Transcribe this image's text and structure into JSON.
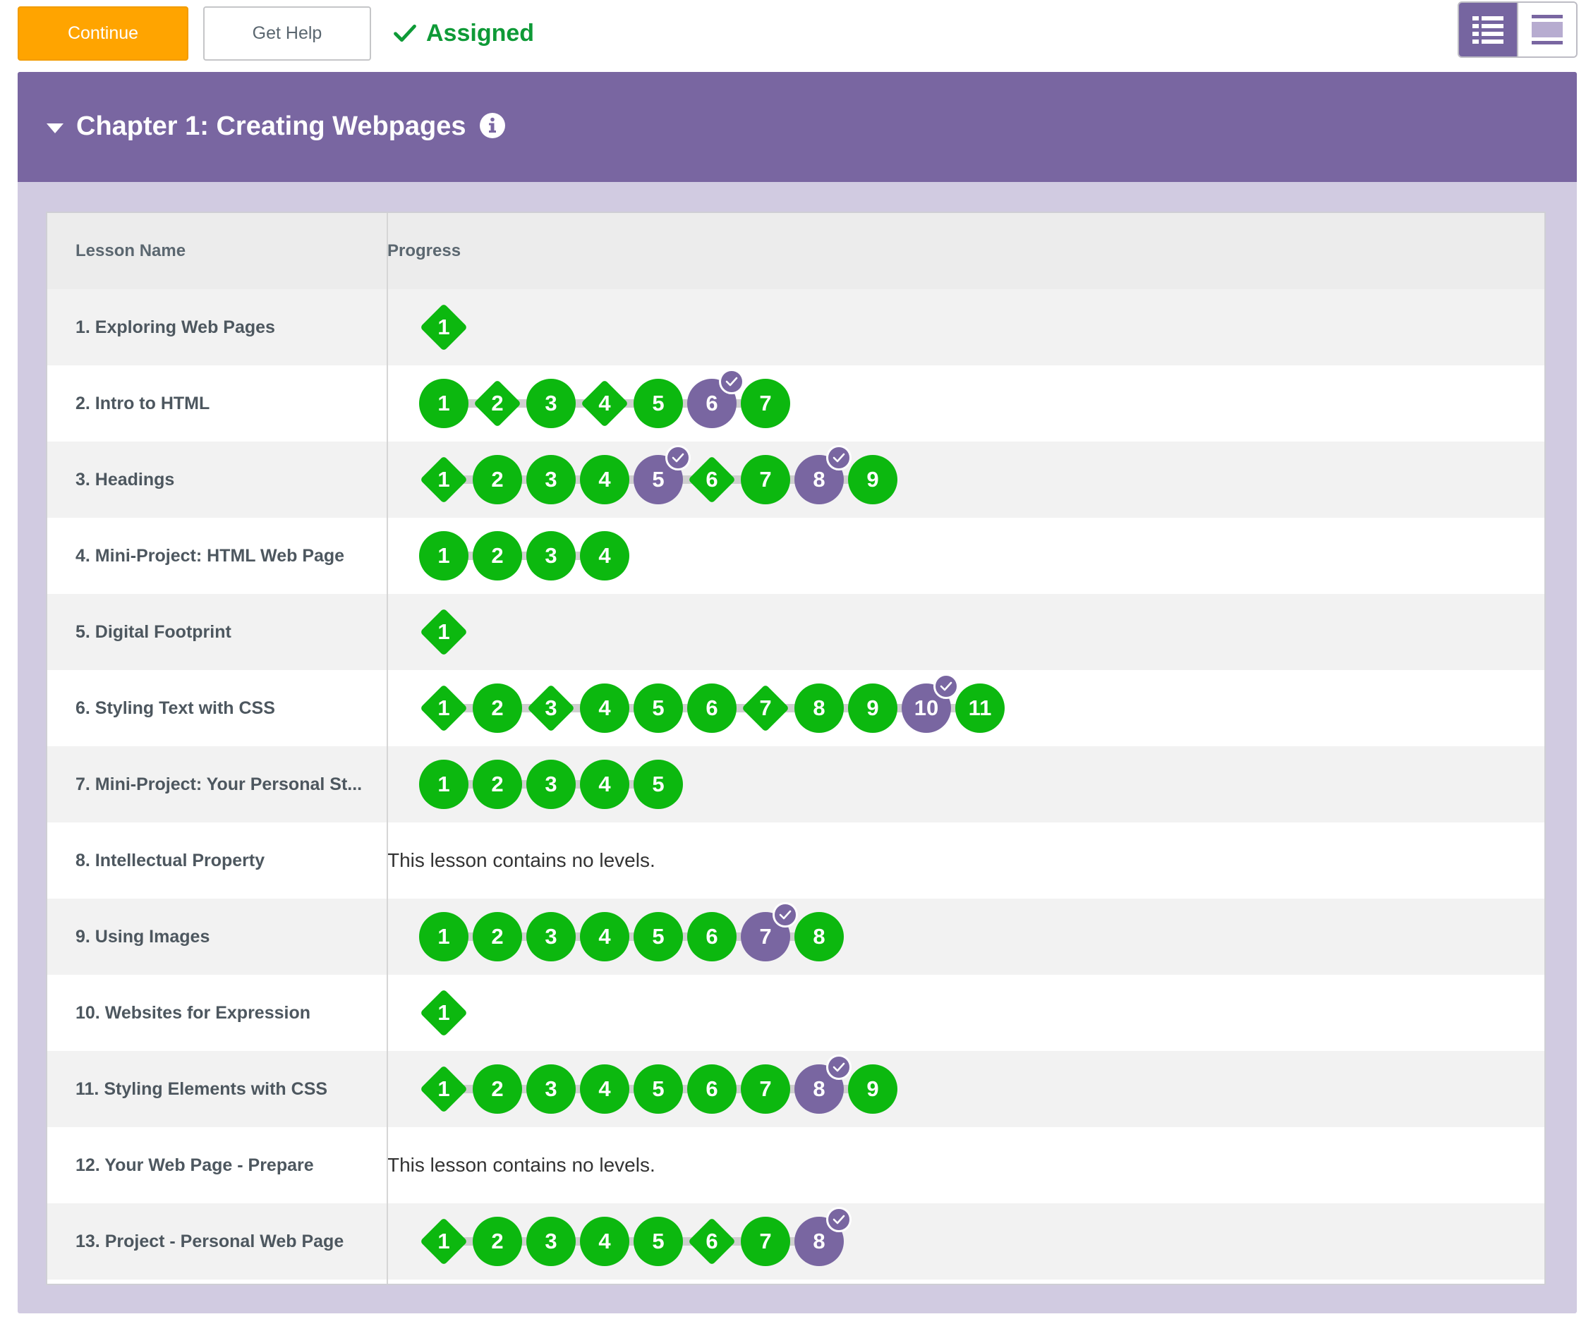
{
  "toolbar": {
    "continue_label": "Continue",
    "help_label": "Get Help",
    "assigned_label": "Assigned"
  },
  "view_toggle": {
    "selected": "detail",
    "options": [
      "detail-view",
      "summary-view"
    ]
  },
  "chapter": {
    "title": "Chapter 1: Creating Webpages"
  },
  "table": {
    "headers": {
      "name": "Lesson Name",
      "progress": "Progress"
    },
    "no_levels_text": "This lesson contains no levels.",
    "lessons": [
      {
        "name": "1. Exploring Web Pages",
        "levels": [
          {
            "n": "1",
            "shape": "diamond"
          }
        ]
      },
      {
        "name": "2. Intro to HTML",
        "levels": [
          {
            "n": "1",
            "shape": "circle"
          },
          {
            "n": "2",
            "shape": "diamond"
          },
          {
            "n": "3",
            "shape": "circle"
          },
          {
            "n": "4",
            "shape": "diamond"
          },
          {
            "n": "5",
            "shape": "circle"
          },
          {
            "n": "6",
            "shape": "assessment"
          },
          {
            "n": "7",
            "shape": "circle"
          }
        ]
      },
      {
        "name": "3. Headings",
        "levels": [
          {
            "n": "1",
            "shape": "diamond"
          },
          {
            "n": "2",
            "shape": "circle"
          },
          {
            "n": "3",
            "shape": "circle"
          },
          {
            "n": "4",
            "shape": "circle"
          },
          {
            "n": "5",
            "shape": "assessment"
          },
          {
            "n": "6",
            "shape": "diamond"
          },
          {
            "n": "7",
            "shape": "circle"
          },
          {
            "n": "8",
            "shape": "assessment"
          },
          {
            "n": "9",
            "shape": "circle"
          }
        ]
      },
      {
        "name": "4. Mini-Project: HTML Web Page",
        "levels": [
          {
            "n": "1",
            "shape": "circle"
          },
          {
            "n": "2",
            "shape": "circle"
          },
          {
            "n": "3",
            "shape": "circle"
          },
          {
            "n": "4",
            "shape": "circle"
          }
        ]
      },
      {
        "name": "5. Digital Footprint",
        "levels": [
          {
            "n": "1",
            "shape": "diamond"
          }
        ]
      },
      {
        "name": "6. Styling Text with CSS",
        "levels": [
          {
            "n": "1",
            "shape": "diamond"
          },
          {
            "n": "2",
            "shape": "circle"
          },
          {
            "n": "3",
            "shape": "diamond"
          },
          {
            "n": "4",
            "shape": "circle"
          },
          {
            "n": "5",
            "shape": "circle"
          },
          {
            "n": "6",
            "shape": "circle"
          },
          {
            "n": "7",
            "shape": "diamond"
          },
          {
            "n": "8",
            "shape": "circle"
          },
          {
            "n": "9",
            "shape": "circle"
          },
          {
            "n": "10",
            "shape": "assessment"
          },
          {
            "n": "11",
            "shape": "circle"
          }
        ]
      },
      {
        "name": "7. Mini-Project: Your Personal St...",
        "levels": [
          {
            "n": "1",
            "shape": "circle"
          },
          {
            "n": "2",
            "shape": "circle"
          },
          {
            "n": "3",
            "shape": "circle"
          },
          {
            "n": "4",
            "shape": "circle"
          },
          {
            "n": "5",
            "shape": "circle"
          }
        ]
      },
      {
        "name": "8. Intellectual Property",
        "levels": []
      },
      {
        "name": "9. Using Images",
        "levels": [
          {
            "n": "1",
            "shape": "circle"
          },
          {
            "n": "2",
            "shape": "circle"
          },
          {
            "n": "3",
            "shape": "circle"
          },
          {
            "n": "4",
            "shape": "circle"
          },
          {
            "n": "5",
            "shape": "circle"
          },
          {
            "n": "6",
            "shape": "circle"
          },
          {
            "n": "7",
            "shape": "assessment"
          },
          {
            "n": "8",
            "shape": "circle"
          }
        ]
      },
      {
        "name": "10. Websites for Expression",
        "levels": [
          {
            "n": "1",
            "shape": "diamond"
          }
        ]
      },
      {
        "name": "11. Styling Elements with CSS",
        "levels": [
          {
            "n": "1",
            "shape": "diamond"
          },
          {
            "n": "2",
            "shape": "circle"
          },
          {
            "n": "3",
            "shape": "circle"
          },
          {
            "n": "4",
            "shape": "circle"
          },
          {
            "n": "5",
            "shape": "circle"
          },
          {
            "n": "6",
            "shape": "circle"
          },
          {
            "n": "7",
            "shape": "circle"
          },
          {
            "n": "8",
            "shape": "assessment"
          },
          {
            "n": "9",
            "shape": "circle"
          }
        ]
      },
      {
        "name": "12. Your Web Page - Prepare",
        "levels": []
      },
      {
        "name": "13. Project - Personal Web Page",
        "levels": [
          {
            "n": "1",
            "shape": "diamond"
          },
          {
            "n": "2",
            "shape": "circle"
          },
          {
            "n": "3",
            "shape": "circle"
          },
          {
            "n": "4",
            "shape": "circle"
          },
          {
            "n": "5",
            "shape": "circle"
          },
          {
            "n": "6",
            "shape": "diamond"
          },
          {
            "n": "7",
            "shape": "circle"
          },
          {
            "n": "8",
            "shape": "assessment"
          }
        ]
      }
    ]
  },
  "colors": {
    "level_complete": "#0cb80f",
    "assessment": "#7966a1",
    "chapter_header": "#7966a1",
    "continue_button": "#ffa400",
    "assigned_text": "#0e9a37"
  }
}
